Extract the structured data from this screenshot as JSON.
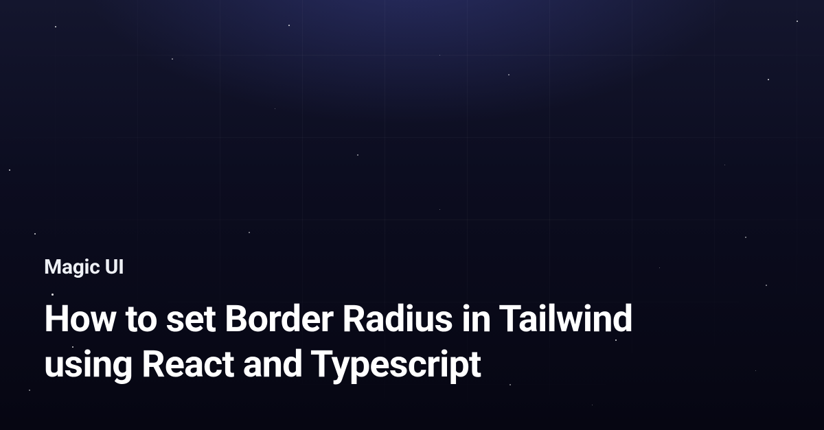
{
  "brand": "Magic UI",
  "title": "How to set Border Radius in Tailwind using React and Typescript"
}
